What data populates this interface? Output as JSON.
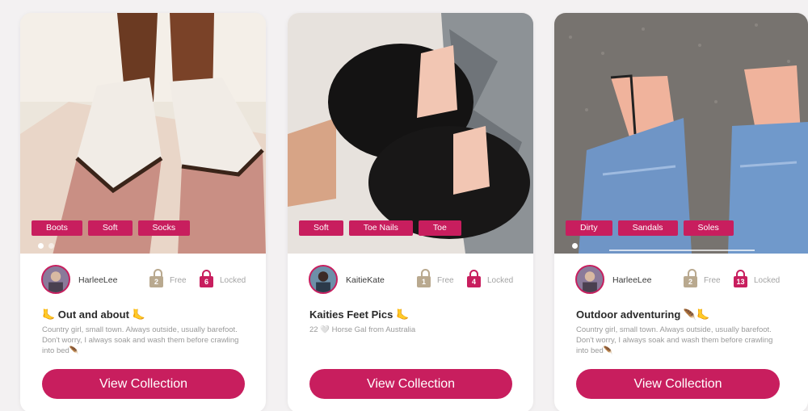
{
  "cards": [
    {
      "tags": [
        "Boots",
        "Soft",
        "Socks"
      ],
      "username": "HarleeLee",
      "free_count": "2",
      "free_label": "Free",
      "locked_count": "6",
      "locked_label": "Locked",
      "title": "🦶 Out and about 🦶",
      "description": "Country girl, small town. Always outside, usually barefoot. Don't worry, I always soak and wash them before crawling into bed🪶",
      "cta_label": "View Collection"
    },
    {
      "tags": [
        "Soft",
        "Toe Nails",
        "Toe"
      ],
      "username": "KaitieKate",
      "free_count": "1",
      "free_label": "Free",
      "locked_count": "4",
      "locked_label": "Locked",
      "title": "Kaities Feet Pics 🦶",
      "description": "22 🤍 Horse Gal from Australia",
      "cta_label": "View Collection"
    },
    {
      "tags": [
        "Dirty",
        "Sandals",
        "Soles"
      ],
      "username": "HarleeLee",
      "free_count": "2",
      "free_label": "Free",
      "locked_count": "13",
      "locked_label": "Locked",
      "title": "Outdoor adventuring 🪶🦶",
      "description": "Country girl, small town. Always outside, usually barefoot. Don't worry, I always soak and wash them before crawling into bed🪶",
      "cta_label": "View Collection"
    }
  ],
  "colors": {
    "accent": "#c81e5e",
    "free_lock": "#b9a98f",
    "page_bg": "#f3f1f2"
  },
  "icons": {
    "free": "unlocked-padlock-icon",
    "locked": "locked-padlock-icon"
  }
}
